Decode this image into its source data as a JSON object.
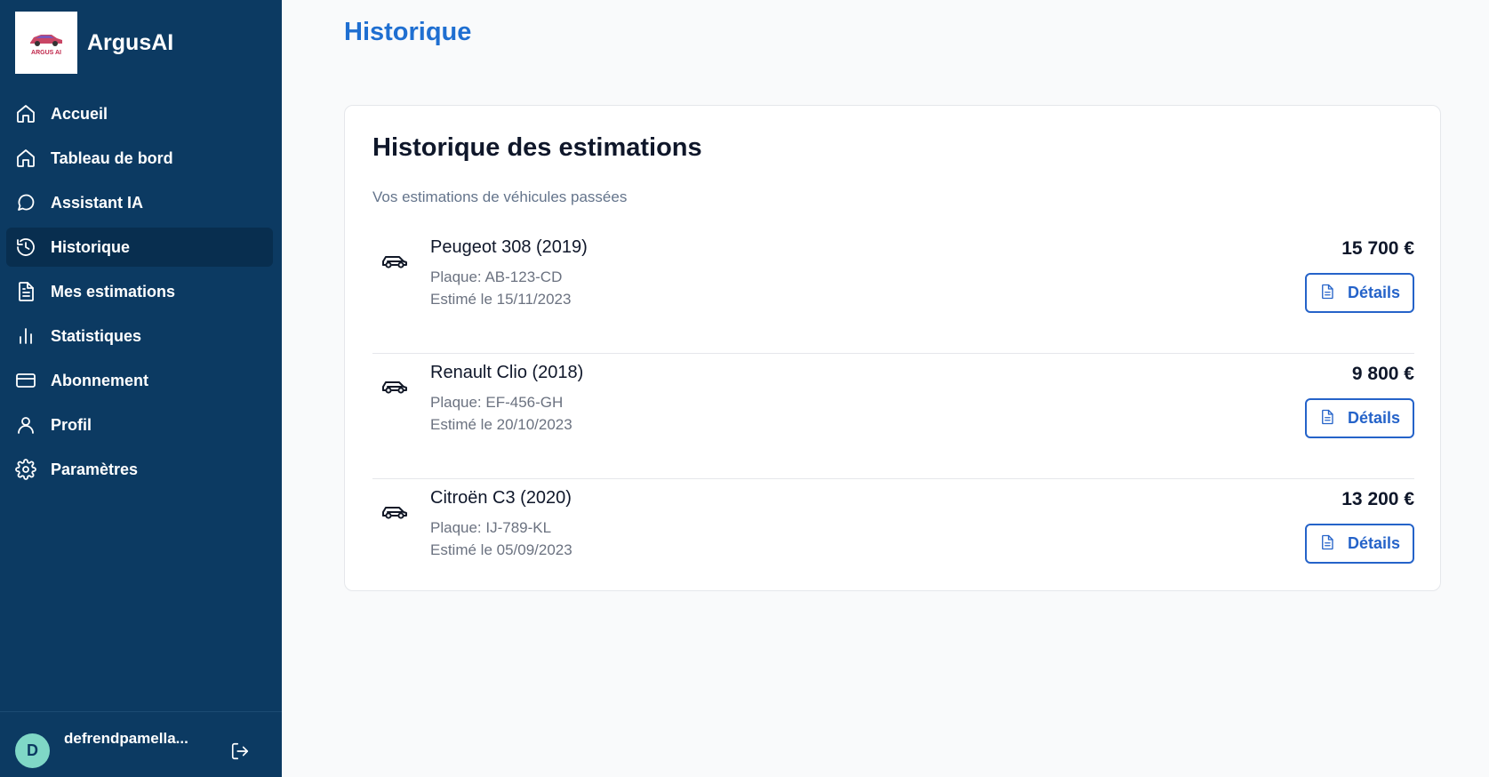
{
  "app": {
    "name": "ArgusAI",
    "logo_text": "ARGUS AI"
  },
  "sidebar": {
    "items": [
      {
        "label": "Accueil",
        "icon": "home-icon"
      },
      {
        "label": "Tableau de bord",
        "icon": "home-icon"
      },
      {
        "label": "Assistant IA",
        "icon": "chat-bubble-icon"
      },
      {
        "label": "Historique",
        "icon": "history-icon",
        "active": true
      },
      {
        "label": "Mes estimations",
        "icon": "document-icon"
      },
      {
        "label": "Statistiques",
        "icon": "bar-chart-icon"
      },
      {
        "label": "Abonnement",
        "icon": "credit-card-icon"
      },
      {
        "label": "Profil",
        "icon": "user-icon"
      },
      {
        "label": "Paramètres",
        "icon": "gear-icon"
      }
    ],
    "user": {
      "initial": "D",
      "name": "defrendpamella..."
    }
  },
  "page": {
    "title": "Historique"
  },
  "card": {
    "title": "Historique des estimations",
    "subtitle": "Vos estimations de véhicules passées",
    "details_label": "Détails",
    "rows": [
      {
        "name": "Peugeot 308 (2019)",
        "plate": "Plaque: AB-123-CD",
        "date": "Estimé le 15/11/2023",
        "price": "15 700 €"
      },
      {
        "name": "Renault Clio (2018)",
        "plate": "Plaque: EF-456-GH",
        "date": "Estimé le 20/10/2023",
        "price": "9 800 €"
      },
      {
        "name": "Citroën C3 (2020)",
        "plate": "Plaque: IJ-789-KL",
        "date": "Estimé le 05/09/2023",
        "price": "13 200 €"
      }
    ]
  },
  "colors": {
    "sidebar_bg": "#0c3a62",
    "sidebar_active": "#082e4f",
    "accent": "#2563c9",
    "title_blue": "#1f6fd1",
    "avatar_bg": "#7fd7c6"
  }
}
